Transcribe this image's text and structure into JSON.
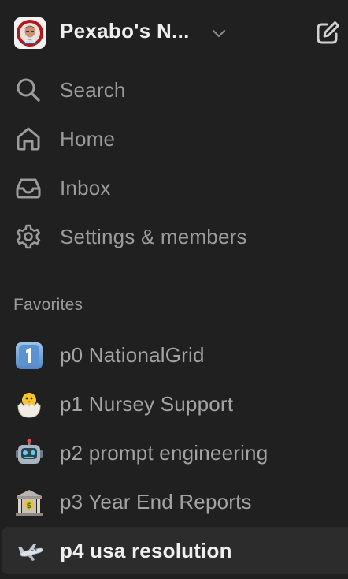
{
  "workspace": {
    "name": "Pexabo's N...",
    "avatar_icon": "profile-photo",
    "menu_icon": "chevron-down-icon",
    "new_page_icon": "edit-icon"
  },
  "nav": {
    "items": [
      {
        "label": "Search",
        "icon": "search-icon"
      },
      {
        "label": "Home",
        "icon": "home-icon"
      },
      {
        "label": "Inbox",
        "icon": "inbox-icon"
      },
      {
        "label": "Settings & members",
        "icon": "gear-icon"
      }
    ]
  },
  "favorites": {
    "title": "Favorites",
    "items": [
      {
        "emoji": "1️⃣",
        "label": "p0 NationalGrid",
        "icon": "keycap-one-icon"
      },
      {
        "emoji": "🐣",
        "label": "p1 Nursey Support",
        "icon": "hatching-chick-icon"
      },
      {
        "emoji": "🤖",
        "label": "p2 prompt engineering",
        "icon": "robot-icon"
      },
      {
        "emoji": "🏦",
        "label": "p3 Year End Reports",
        "icon": "bank-icon"
      },
      {
        "emoji": "🛩",
        "label": "p4 usa resolution",
        "icon": "airplane-icon",
        "selected": true
      }
    ]
  },
  "colors": {
    "background": "#202020",
    "selected_row": "#2c2c2c",
    "muted_text": "#9b9b9b",
    "primary_text": "#eeeeee"
  }
}
